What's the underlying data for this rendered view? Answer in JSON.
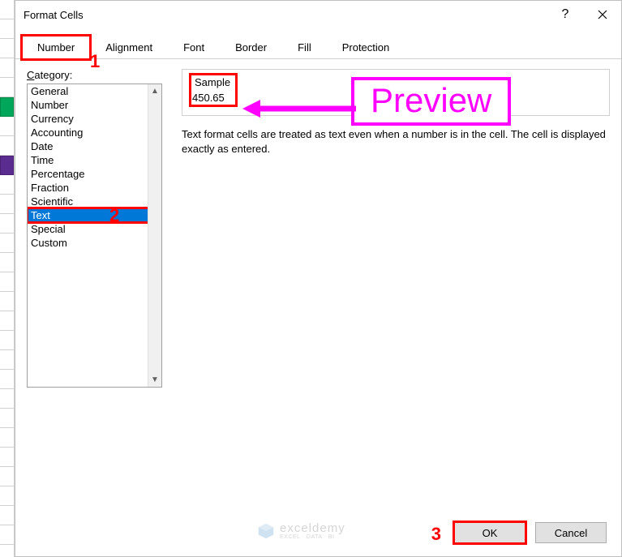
{
  "dialog": {
    "title": "Format Cells"
  },
  "tabs": {
    "number": "Number",
    "alignment": "Alignment",
    "font": "Font",
    "border": "Border",
    "fill": "Fill",
    "protection": "Protection"
  },
  "category": {
    "label": "Category:",
    "items": [
      "General",
      "Number",
      "Currency",
      "Accounting",
      "Date",
      "Time",
      "Percentage",
      "Fraction",
      "Scientific",
      "Text",
      "Special",
      "Custom"
    ],
    "selected": "Text"
  },
  "sample": {
    "label": "Sample",
    "value": "450.65"
  },
  "description": "Text format cells are treated as text even when a number is in the cell. The cell is displayed exactly as entered.",
  "buttons": {
    "ok": "OK",
    "cancel": "Cancel"
  },
  "callouts": {
    "one": "1",
    "two": "2",
    "three": "3",
    "preview": "Preview"
  },
  "watermark": {
    "brand": "exceldemy",
    "tagline": "EXCEL · DATA · BI"
  }
}
